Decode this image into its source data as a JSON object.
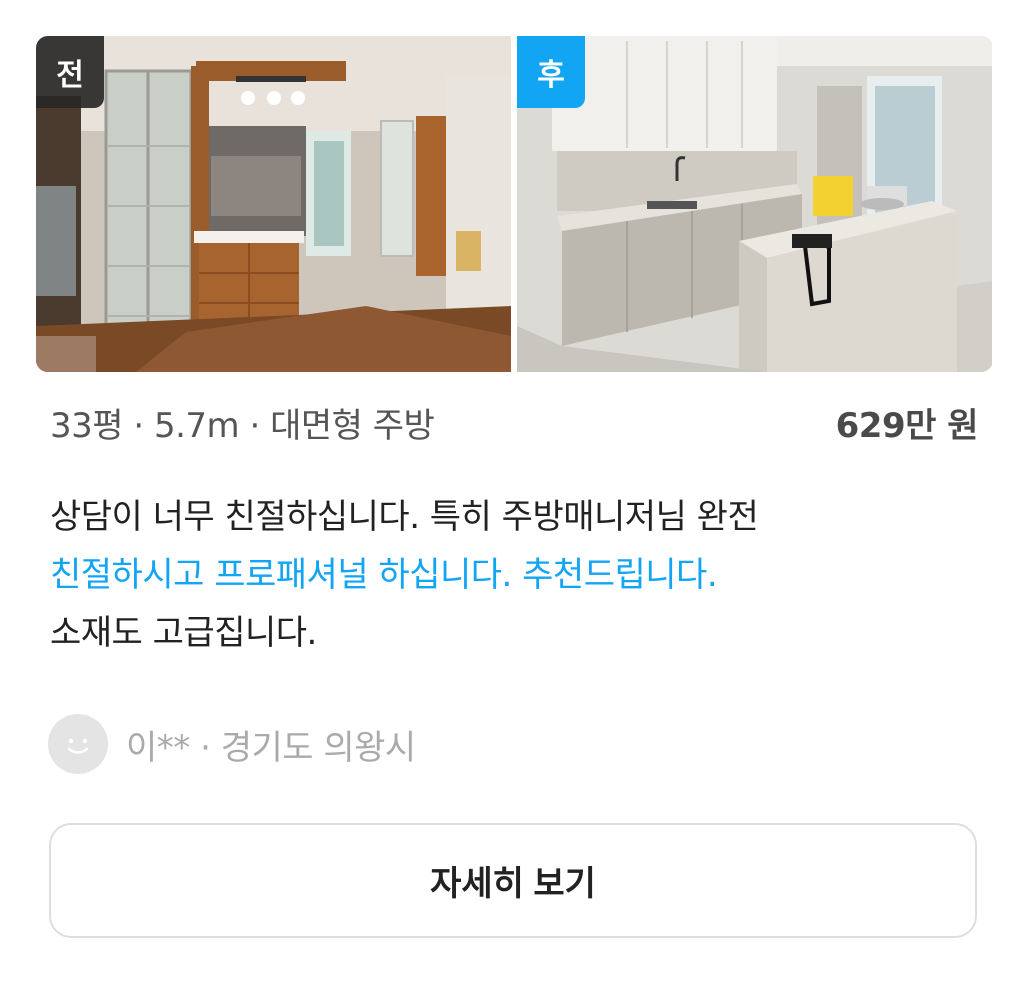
{
  "photos": {
    "before": {
      "badge": "전",
      "badge_color": "#2a2a2a",
      "image": "kitchen-before-photo"
    },
    "after": {
      "badge": "후",
      "badge_color": "#12a5f4",
      "image": "kitchen-after-photo"
    }
  },
  "meta": {
    "specs": "33평 · 5.7m · 대면형 주방",
    "price": "629만 원"
  },
  "review": {
    "line1": "상담이 너무 친절하십니다. 특히 주방매니저님 완전",
    "line2": "친절하시고 프로패셔널 하십니다. 추천드립니다.",
    "line3": "소재도 고급집니다.",
    "highlight_color": "#12a5f4"
  },
  "author": {
    "text": "이** · 경기도 의왕시",
    "avatar_icon": "smiley-avatar-icon"
  },
  "button": {
    "label": "자세히 보기"
  }
}
